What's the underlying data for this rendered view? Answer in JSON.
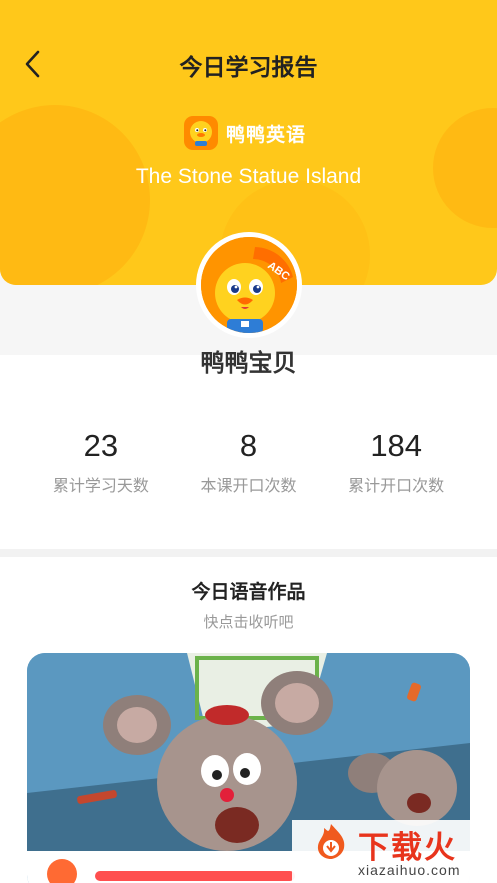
{
  "nav": {
    "title": "今日学习报告"
  },
  "brand": {
    "name": "鸭鸭英语"
  },
  "lesson": {
    "name": "The Stone Statue Island"
  },
  "avatar": {
    "badge": "ABC"
  },
  "user": {
    "nickname": "鸭鸭宝贝"
  },
  "stats": [
    {
      "value": "23",
      "label": "累计学习天数"
    },
    {
      "value": "8",
      "label": "本课开口次数"
    },
    {
      "value": "184",
      "label": "累计开口次数"
    }
  ],
  "works": {
    "title": "今日语音作品",
    "subtitle": "快点击收听吧"
  },
  "watermark": {
    "text": "下载火",
    "url": "xiazaihuo.com"
  },
  "colors": {
    "header": "#ffc81a",
    "accent": "#ff8a00",
    "progress": "#ff4f4f"
  }
}
